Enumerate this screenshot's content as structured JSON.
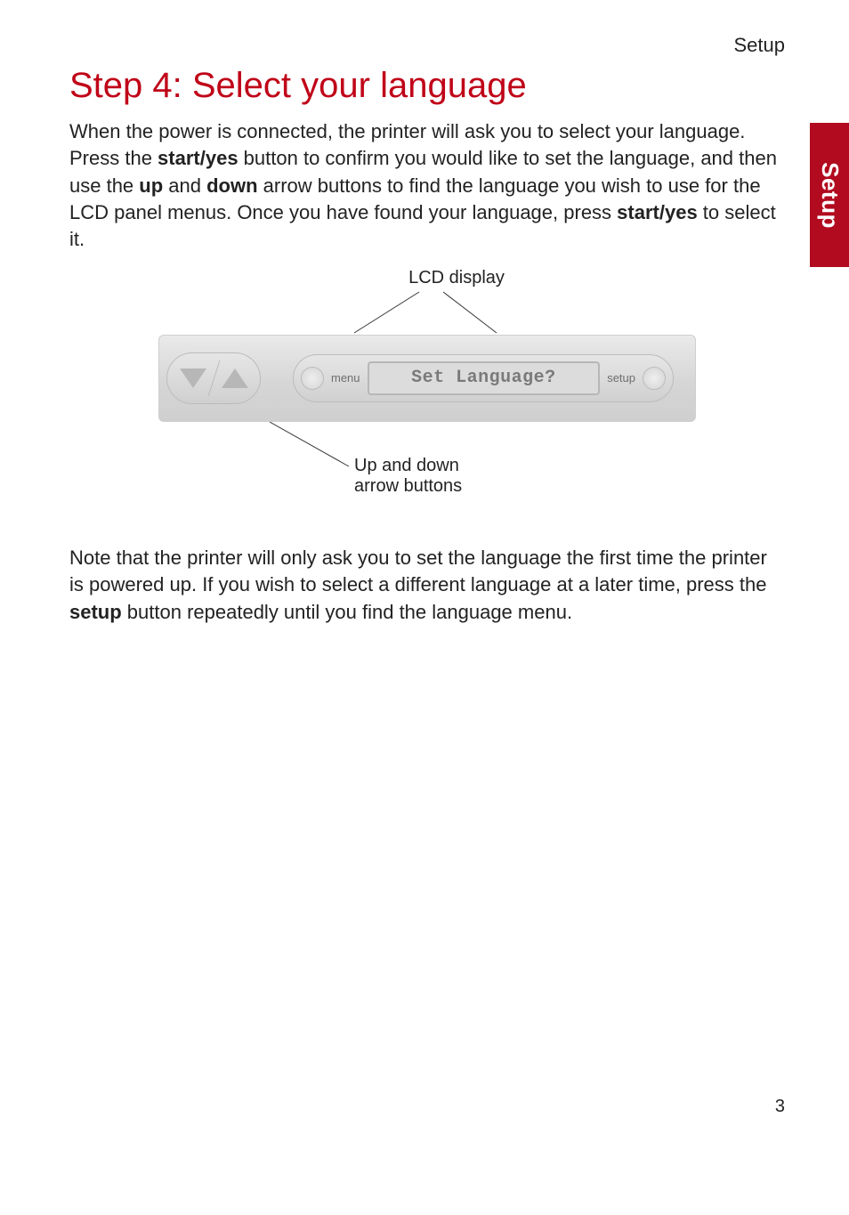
{
  "header": {
    "section": "Setup"
  },
  "sideTab": {
    "label": "Setup"
  },
  "title": "Step 4: Select your language",
  "para1": {
    "t1": "When the power is connected, the printer will ask you to select your language. Press the ",
    "b1": "start/yes",
    "t2": " button to confirm you would like to set the language, and then use the ",
    "b2": "up",
    "t3": " and ",
    "b3": "down",
    "t4": " arrow buttons to find the language you wish to use for the LCD panel menus. Once you have found your language, press ",
    "b4": "start/yes",
    "t5": " to select it."
  },
  "diagram": {
    "lcdLabel": "LCD display",
    "updownLabel1": "Up and down",
    "updownLabel2": "arrow buttons",
    "menuLabel": "menu",
    "setupLabel": "setup",
    "lcdText": "Set Language?"
  },
  "note": {
    "t1": "Note that the printer will only ask you to set the language the first time the printer is powered up. If you wish to select a different language at a later time, press the ",
    "b1": "setup",
    "t2": " button repeatedly until you find the language menu."
  },
  "pageNumber": "3"
}
